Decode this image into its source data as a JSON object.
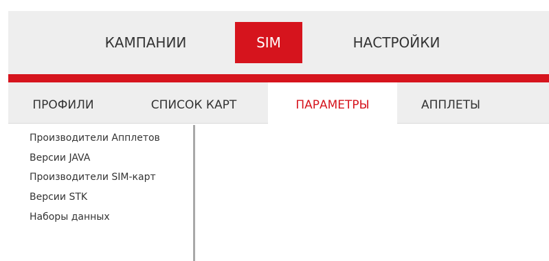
{
  "top_nav": {
    "tabs": [
      {
        "label": "КАМПАНИИ",
        "active": false
      },
      {
        "label": "SIM",
        "active": true
      },
      {
        "label": "НАСТРОЙКИ",
        "active": false
      }
    ]
  },
  "sub_nav": {
    "tabs": [
      {
        "label": "ПРОФИЛИ",
        "active": false
      },
      {
        "label": "СПИСОК КАРТ",
        "active": false
      },
      {
        "label": "ПАРАМЕТРЫ",
        "active": true
      },
      {
        "label": "АППЛЕТЫ",
        "active": false
      }
    ]
  },
  "side_menu": {
    "items": [
      {
        "label": "Производители Апплетов"
      },
      {
        "label": "Версии JAVA"
      },
      {
        "label": "Производители SIM-карт"
      },
      {
        "label": "Версии STK"
      },
      {
        "label": "Наборы данных"
      }
    ]
  },
  "colors": {
    "accent": "#d6141d",
    "nav_background": "#eeeeee",
    "text": "#333333",
    "divider": "#a8a8a8"
  }
}
